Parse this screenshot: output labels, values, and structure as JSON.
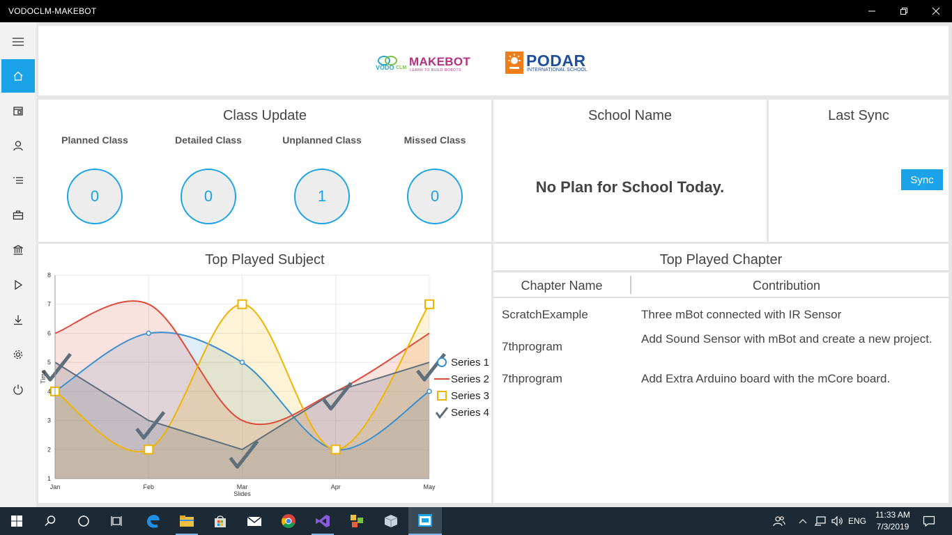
{
  "window": {
    "title": "VODOCLM-MAKEBOT"
  },
  "header": {
    "logo_makebot_text": "MAKEBOT",
    "logo_makebot_tagline": "LEARN TO BUILD ROBOTS",
    "logo_vodo_text": "VODO",
    "logo_clm_text": "CLM",
    "logo_podar_text": "PODAR",
    "logo_podar_sub": "INTERNATIONAL SCHOOL"
  },
  "class_update": {
    "title": "Class Update",
    "stats": [
      {
        "label": "Planned Class",
        "value": "0"
      },
      {
        "label": "Detailed Class",
        "value": "0"
      },
      {
        "label": "Unplanned Class",
        "value": "1"
      },
      {
        "label": "Missed Class",
        "value": "0"
      }
    ]
  },
  "school": {
    "title": "School Name",
    "message": "No Plan for School Today."
  },
  "sync": {
    "title": "Last Sync",
    "button_label": "Sync"
  },
  "subject_chart": {
    "title": "Top Played Subject"
  },
  "chapter": {
    "title": "Top Played Chapter",
    "columns": [
      "Chapter Name",
      "Contribution"
    ],
    "rows": [
      {
        "name": "ScratchExample",
        "contribution": "Three mBot connected with IR Sensor"
      },
      {
        "name": "7thprogram",
        "contribution": "Add Sound Sensor with mBot and create a new project."
      },
      {
        "name": "7thprogram",
        "contribution": "Add Extra Arduino board with the mCore board."
      }
    ]
  },
  "chart_data": {
    "type": "area",
    "title": "",
    "xlabel": "Slides",
    "ylabel": "Time",
    "categories": [
      "Jan",
      "Feb",
      "Mar",
      "Apr",
      "May"
    ],
    "ylim": [
      1,
      8
    ],
    "yticks": [
      "1",
      "2",
      "3",
      "4",
      "5",
      "6",
      "7",
      "8"
    ],
    "grid": true,
    "legend": "right",
    "series": [
      {
        "name": "Series 1",
        "values": [
          4,
          6,
          5,
          2,
          4
        ],
        "color": "#3a8fd0",
        "marker": "circle"
      },
      {
        "name": "Series 2",
        "values": [
          6,
          7,
          3,
          4,
          6
        ],
        "color": "#e04a3a",
        "marker": "none"
      },
      {
        "name": "Series 3",
        "values": [
          4,
          2,
          7,
          2,
          7
        ],
        "color": "#f0b400",
        "marker": "square"
      },
      {
        "name": "Series 4",
        "values": [
          5,
          3,
          2,
          4,
          5
        ],
        "color": "#5e6f7c",
        "marker": "check"
      }
    ]
  },
  "taskbar": {
    "language": "ENG",
    "time": "11:33 AM",
    "date": "7/3/2019"
  }
}
